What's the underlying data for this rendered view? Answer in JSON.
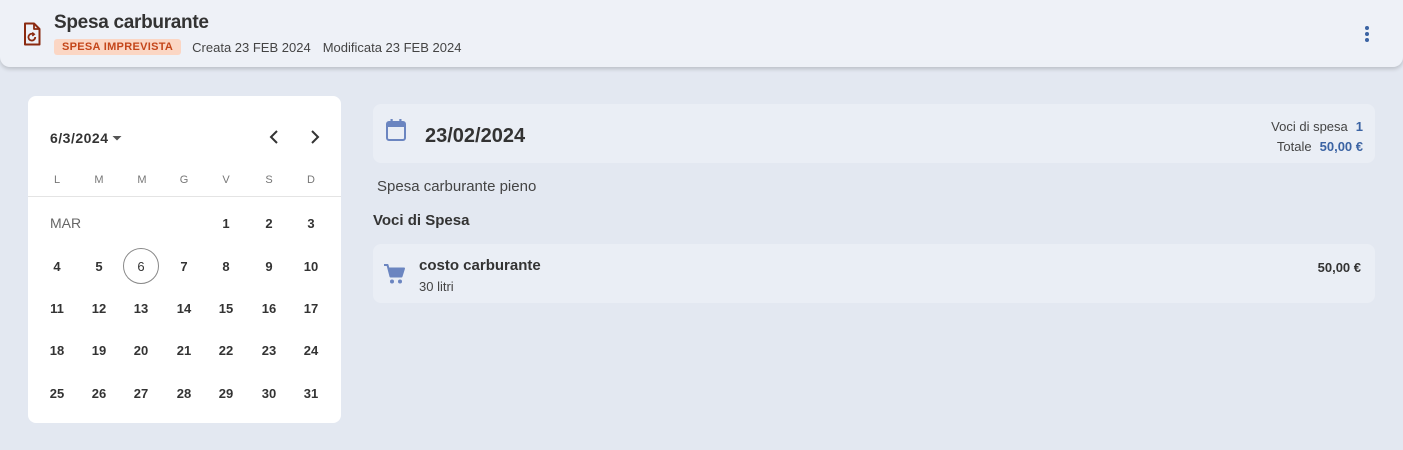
{
  "header": {
    "title": "Spesa carburante",
    "badge": "SPESA IMPREVISTA",
    "created": "Creata 23 FEB 2024",
    "modified": "Modificata 23 FEB 2024",
    "doc_icon": "document-icon",
    "menu_icon": "more-vert-icon"
  },
  "calendar": {
    "selected_label": "6/3/2024",
    "weekdays": [
      "L",
      "M",
      "M",
      "G",
      "V",
      "S",
      "D"
    ],
    "month_label": "MAR",
    "today": "6",
    "weeks": [
      [
        "",
        "",
        "",
        "",
        "1",
        "2",
        "3"
      ],
      [
        "4",
        "5",
        "6",
        "7",
        "8",
        "9",
        "10"
      ],
      [
        "11",
        "12",
        "13",
        "14",
        "15",
        "16",
        "17"
      ],
      [
        "18",
        "19",
        "20",
        "21",
        "22",
        "23",
        "24"
      ],
      [
        "25",
        "26",
        "27",
        "28",
        "29",
        "30",
        "31"
      ]
    ]
  },
  "detail": {
    "date": "23/02/2024",
    "voci_label": "Voci di spesa",
    "voci_value": "1",
    "totale_label": "Totale",
    "totale_value": "50,00 €",
    "description": "Spesa carburante pieno",
    "section_title": "Voci di Spesa",
    "items": [
      {
        "name": "costo carburante",
        "quantity": "30 litri",
        "amount": "50,00 €",
        "icon": "cart-icon"
      }
    ]
  },
  "colors": {
    "accent": "#3b63a3",
    "badge_bg": "#fbd6c4",
    "badge_text": "#c4461a",
    "doc_icon": "#8b2a10"
  }
}
